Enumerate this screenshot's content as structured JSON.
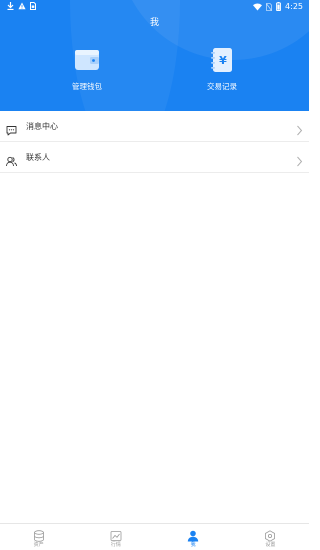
{
  "status_bar": {
    "time": "4:25",
    "icons": [
      "download-icon",
      "warning-icon",
      "sim-icon",
      "wifi-icon",
      "battery-icon"
    ]
  },
  "header": {
    "title": "我",
    "actions": [
      {
        "label": "管理钱包",
        "icon": "wallet-icon"
      },
      {
        "label": "交易记录",
        "icon": "transaction-record-icon",
        "glyph": "¥"
      }
    ]
  },
  "menu": [
    {
      "label": "消息中心",
      "icon": "message-icon"
    },
    {
      "label": "联系人",
      "icon": "contacts-icon"
    }
  ],
  "tabs": [
    {
      "label": "资产",
      "icon": "assets-icon",
      "active": false
    },
    {
      "label": "行情",
      "icon": "market-icon",
      "active": false
    },
    {
      "label": "我",
      "icon": "profile-icon",
      "active": true
    },
    {
      "label": "设置",
      "icon": "settings-icon",
      "active": false
    }
  ],
  "colors": {
    "accent": "#1a82f2",
    "inactive": "#999999"
  }
}
